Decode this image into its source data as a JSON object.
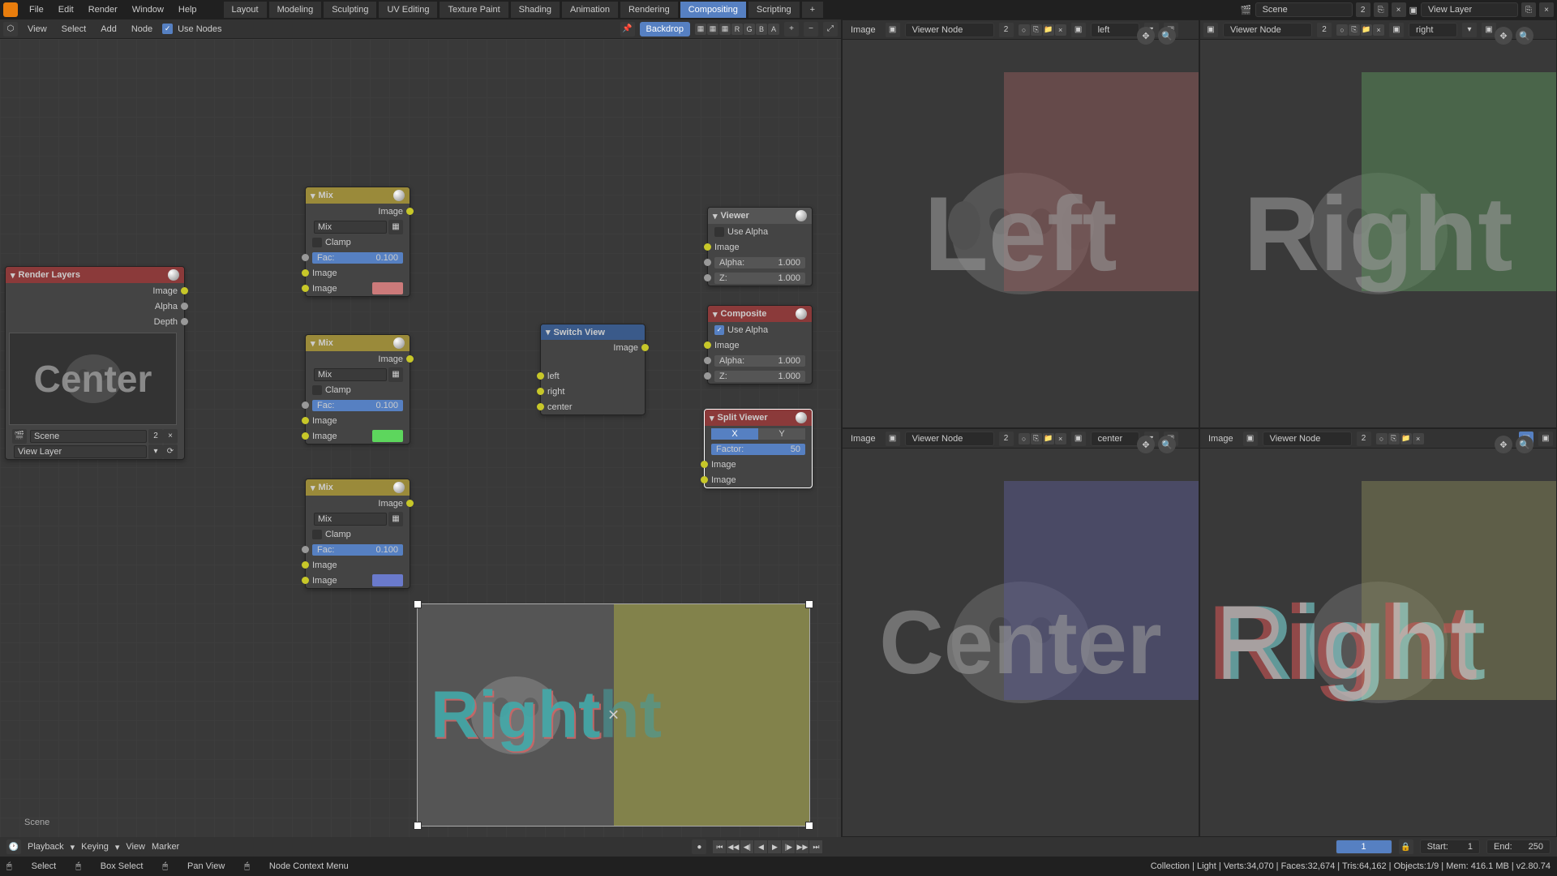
{
  "topbar": {
    "menus": [
      "File",
      "Edit",
      "Render",
      "Window",
      "Help"
    ],
    "tabs": [
      "Layout",
      "Modeling",
      "Sculpting",
      "UV Editing",
      "Texture Paint",
      "Shading",
      "Animation",
      "Rendering",
      "Compositing",
      "Scripting"
    ],
    "active_tab": "Compositing",
    "scene": "Scene",
    "scene_users": "2",
    "viewlayer": "View Layer"
  },
  "node_hdr": {
    "view": "View",
    "select": "Select",
    "add": "Add",
    "node": "Node",
    "use_nodes": "Use Nodes",
    "backdrop": "Backdrop"
  },
  "img_hdrs": [
    {
      "label": "Image",
      "node": "Viewer Node",
      "users": "2",
      "slot": "left"
    },
    {
      "label": "Image",
      "node": "Viewer Node",
      "users": "2",
      "slot": "right"
    },
    {
      "label": "Image",
      "node": "Viewer Node",
      "users": "2",
      "slot": "center"
    },
    {
      "label": "Image",
      "node": "Viewer Node",
      "users": "2",
      "slot": ""
    }
  ],
  "nodes": {
    "render_layers": {
      "title": "Render Layers",
      "outs": [
        "Image",
        "Alpha",
        "Depth"
      ],
      "scene": "Scene",
      "scene_users": "2",
      "layer": "View Layer",
      "thumb": "Center"
    },
    "mix": [
      {
        "title": "Mix",
        "mode": "Mix",
        "clamp": "Clamp",
        "fac_l": "Fac:",
        "fac": "0.100",
        "img": "Image",
        "color": "#cc7a7a"
      },
      {
        "title": "Mix",
        "mode": "Mix",
        "clamp": "Clamp",
        "fac_l": "Fac:",
        "fac": "0.100",
        "img": "Image",
        "color": "#5dd65d"
      },
      {
        "title": "Mix",
        "mode": "Mix",
        "clamp": "Clamp",
        "fac_l": "Fac:",
        "fac": "0.100",
        "img": "Image",
        "color": "#6a7acc"
      }
    ],
    "switch": {
      "title": "Switch View",
      "out": "Image",
      "ins": [
        "left",
        "right",
        "center"
      ]
    },
    "viewer": {
      "title": "Viewer",
      "use_alpha": "Use Alpha",
      "img": "Image",
      "alpha_l": "Alpha:",
      "alpha": "1.000",
      "z_l": "Z:",
      "z": "1.000"
    },
    "composite": {
      "title": "Composite",
      "use_alpha": "Use Alpha",
      "img": "Image",
      "alpha_l": "Alpha:",
      "alpha": "1.000",
      "z_l": "Z:",
      "z": "1.000"
    },
    "split": {
      "title": "Split Viewer",
      "x": "X",
      "y": "Y",
      "factor_l": "Factor:",
      "factor": "50",
      "img": "Image"
    }
  },
  "panes": {
    "labels": [
      "Left",
      "Right",
      "Center",
      "Right"
    ],
    "overlay_colors": [
      "#8b5a5a",
      "#5a8b5a",
      "#5a5a8b",
      "#8b8b5a"
    ]
  },
  "timeline": {
    "playback": "Playback",
    "keying": "Keying",
    "view": "View",
    "marker": "Marker",
    "cur": "1",
    "start_l": "Start:",
    "start": "1",
    "end_l": "End:",
    "end": "250"
  },
  "status": {
    "select": "Select",
    "box": "Box Select",
    "pan": "Pan View",
    "ctx": "Node Context Menu",
    "info": "Collection | Light | Verts:34,070 | Faces:32,674 | Tris:64,162 | Objects:1/9 | Mem: 416.1 MB | v2.80.74"
  },
  "scene_label": "Scene"
}
